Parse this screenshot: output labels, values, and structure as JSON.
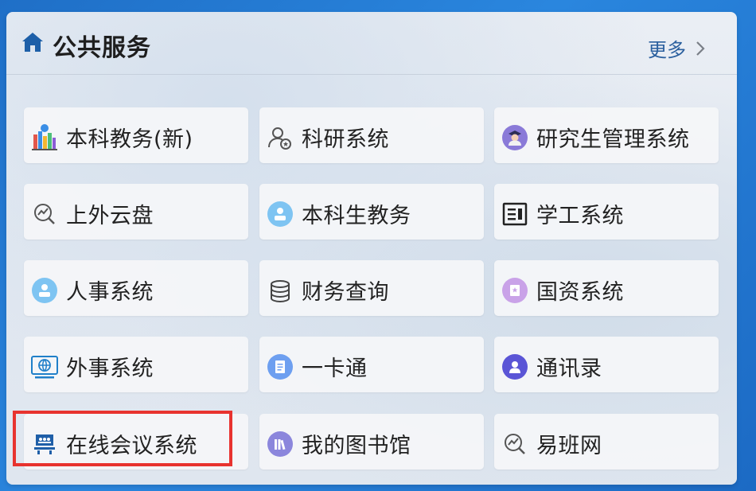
{
  "panel": {
    "title": "公共服务",
    "more_label": "更多"
  },
  "services": [
    {
      "label": "本科教务(新)",
      "icon": "books-icon"
    },
    {
      "label": "科研系统",
      "icon": "user-research-icon"
    },
    {
      "label": "研究生管理系统",
      "icon": "graduate-avatar-icon"
    },
    {
      "label": "上外云盘",
      "icon": "search-chart-icon"
    },
    {
      "label": "本科生教务",
      "icon": "person-circle-icon"
    },
    {
      "label": "学工系统",
      "icon": "newspaper-icon"
    },
    {
      "label": "人事系统",
      "icon": "person-circle-icon"
    },
    {
      "label": "财务查询",
      "icon": "coin-stack-icon"
    },
    {
      "label": "国资系统",
      "icon": "badge-icon"
    },
    {
      "label": "外事系统",
      "icon": "globe-monitor-icon"
    },
    {
      "label": "一卡通",
      "icon": "card-document-icon"
    },
    {
      "label": "通讯录",
      "icon": "contact-icon"
    },
    {
      "label": "在线会议系统",
      "icon": "meeting-icon"
    },
    {
      "label": "我的图书馆",
      "icon": "library-icon"
    },
    {
      "label": "易班网",
      "icon": "search-chart-icon"
    }
  ],
  "highlighted_item": "在线会议系统"
}
